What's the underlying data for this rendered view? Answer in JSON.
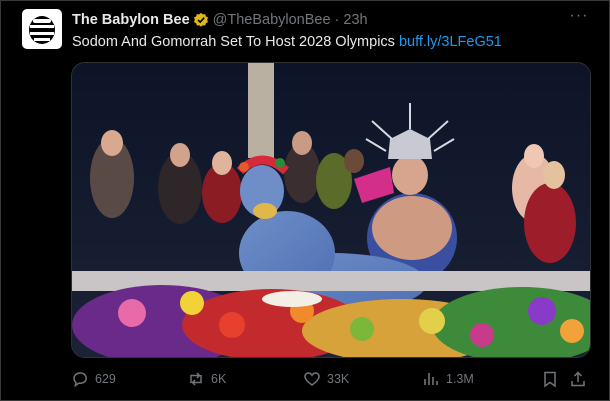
{
  "tweet": {
    "author_name": "The Babylon Bee",
    "handle": "@TheBabylonBee",
    "separator": "·",
    "time": "23h",
    "more_label": "···",
    "text": "Sodom And Gomorrah Set To Host 2028 Olympics",
    "link": "buff.ly/3LFeG51"
  },
  "actions": {
    "replies": "629",
    "reposts": "6K",
    "likes": "33K",
    "views": "1.3M"
  },
  "icons": {
    "avatar": "bee-logo-icon",
    "verified": "verified-badge-icon",
    "reply": "reply-icon",
    "repost": "repost-icon",
    "like": "heart-icon",
    "views": "views-chart-icon",
    "bookmark": "bookmark-icon",
    "share": "share-icon"
  },
  "colors": {
    "background": "#000000",
    "text": "#e7e9ea",
    "muted": "#71767b",
    "link": "#1d9bf0",
    "verified": "#e2b719"
  }
}
